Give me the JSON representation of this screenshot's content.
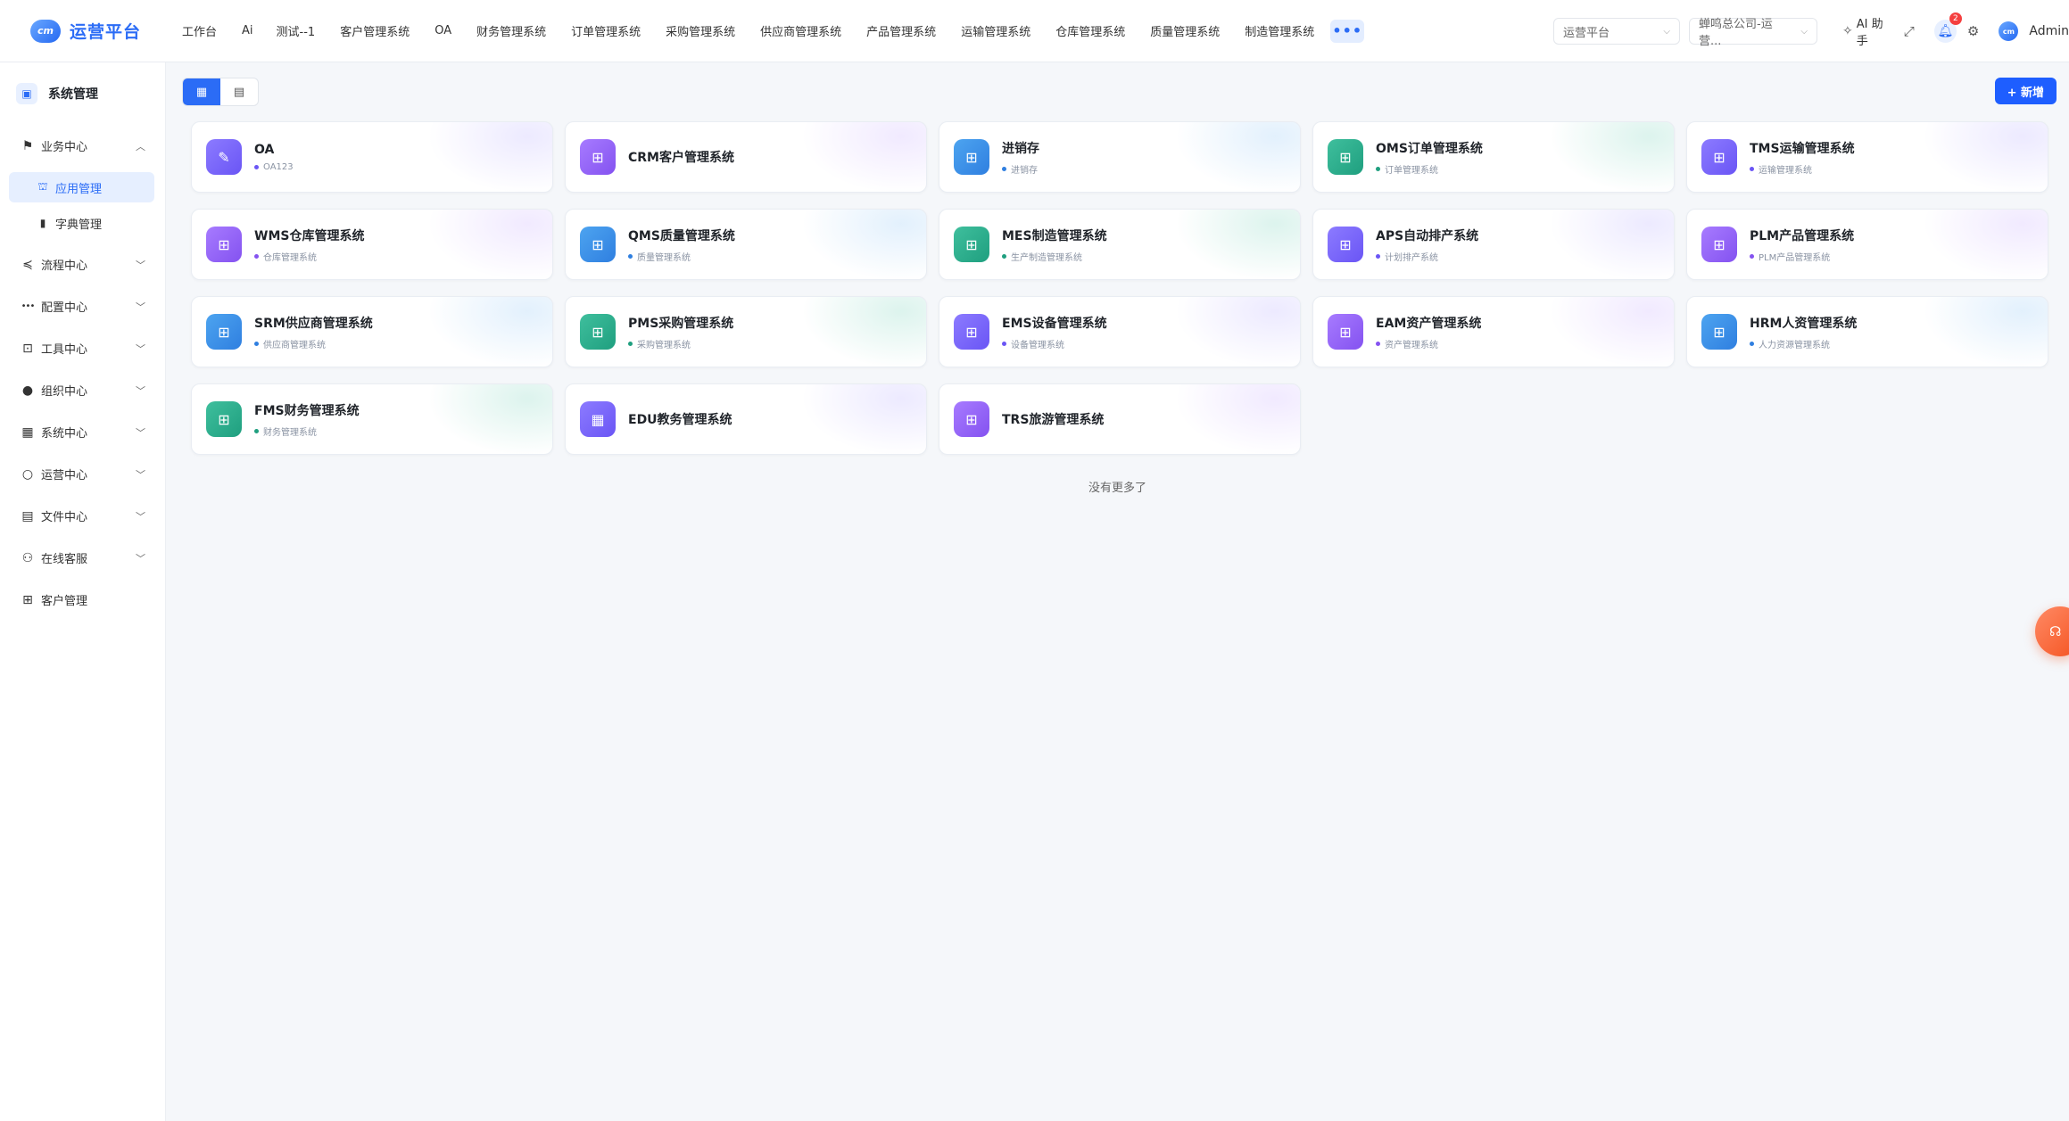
{
  "brand": {
    "logo_text": "cm",
    "name": "运营平台"
  },
  "nav": {
    "items": [
      "工作台",
      "Ai",
      "测试--1",
      "客户管理系统",
      "OA",
      "财务管理系统",
      "订单管理系统",
      "采购管理系统",
      "供应商管理系统",
      "产品管理系统",
      "运输管理系统",
      "仓库管理系统",
      "质量管理系统",
      "制造管理系统"
    ],
    "more_label": "•••"
  },
  "header": {
    "platform_select": "运营平台",
    "company_select": "蝉鸣总公司-运营...",
    "ai_label": "AI 助手",
    "notification_count": "2",
    "avatar_text": "cm",
    "user_name": "Admin"
  },
  "sidebar": {
    "title": "系统管理",
    "items": [
      {
        "label": "业务中心",
        "icon": "flag-icon",
        "glyph": "⚑",
        "expanded": true,
        "children": [
          {
            "label": "应用管理",
            "icon": "bag-icon",
            "glyph": "⛫",
            "active": true
          },
          {
            "label": "字典管理",
            "icon": "book-icon",
            "glyph": "▮",
            "active": false
          }
        ]
      },
      {
        "label": "流程中心",
        "icon": "flow-icon",
        "glyph": "≼"
      },
      {
        "label": "配置中心",
        "icon": "dots-icon",
        "glyph": "•••"
      },
      {
        "label": "工具中心",
        "icon": "toolbox-icon",
        "glyph": "⊡"
      },
      {
        "label": "组织中心",
        "icon": "person-icon",
        "glyph": "●"
      },
      {
        "label": "系统中心",
        "icon": "grid-icon",
        "glyph": "▦"
      },
      {
        "label": "运营中心",
        "icon": "user-outline-icon",
        "glyph": "○"
      },
      {
        "label": "文件中心",
        "icon": "folder-icon",
        "glyph": "▤"
      },
      {
        "label": "在线客服",
        "icon": "support-icon",
        "glyph": "⚇"
      },
      {
        "label": "客户管理",
        "icon": "apps-icon",
        "glyph": "⊞"
      }
    ]
  },
  "toolbar": {
    "add_label": "+ 新增"
  },
  "apps": [
    {
      "title": "OA",
      "sub": "OA123",
      "color": "purple",
      "dot": "#6a55f5",
      "glyph": "✎"
    },
    {
      "title": "CRM客户管理系统",
      "sub": "",
      "color": "violet",
      "dot": "#8452f0",
      "glyph": "⊞"
    },
    {
      "title": "进销存",
      "sub": "进销存",
      "color": "blue",
      "dot": "#2f7fe0",
      "glyph": "⊞"
    },
    {
      "title": "OMS订单管理系统",
      "sub": "订单管理系统",
      "color": "teal",
      "dot": "#1f9f7f",
      "glyph": "⊞"
    },
    {
      "title": "TMS运输管理系统",
      "sub": "运输管理系统",
      "color": "purple",
      "dot": "#6a55f5",
      "glyph": "⊞"
    },
    {
      "title": "WMS仓库管理系统",
      "sub": "仓库管理系统",
      "color": "violet",
      "dot": "#8452f0",
      "glyph": "⊞"
    },
    {
      "title": "QMS质量管理系统",
      "sub": "质量管理系统",
      "color": "blue",
      "dot": "#2f7fe0",
      "glyph": "⊞"
    },
    {
      "title": "MES制造管理系统",
      "sub": "生产制造管理系统",
      "color": "teal",
      "dot": "#1f9f7f",
      "glyph": "⊞"
    },
    {
      "title": "APS自动排产系统",
      "sub": "计划排产系统",
      "color": "purple",
      "dot": "#6a55f5",
      "glyph": "⊞"
    },
    {
      "title": "PLM产品管理系统",
      "sub": "PLM产品管理系统",
      "color": "violet",
      "dot": "#8452f0",
      "glyph": "⊞"
    },
    {
      "title": "SRM供应商管理系统",
      "sub": "供应商管理系统",
      "color": "blue",
      "dot": "#2f7fe0",
      "glyph": "⊞"
    },
    {
      "title": "PMS采购管理系统",
      "sub": "采购管理系统",
      "color": "teal",
      "dot": "#1f9f7f",
      "glyph": "⊞"
    },
    {
      "title": "EMS设备管理系统",
      "sub": "设备管理系统",
      "color": "purple",
      "dot": "#6a55f5",
      "glyph": "⊞"
    },
    {
      "title": "EAM资产管理系统",
      "sub": "资产管理系统",
      "color": "violet",
      "dot": "#8452f0",
      "glyph": "⊞"
    },
    {
      "title": "HRM人资管理系统",
      "sub": "人力资源管理系统",
      "color": "blue",
      "dot": "#2f7fe0",
      "glyph": "⊞"
    },
    {
      "title": "FMS财务管理系统",
      "sub": "财务管理系统",
      "color": "teal",
      "dot": "#1f9f7f",
      "glyph": "⊞"
    },
    {
      "title": "EDU教务管理系统",
      "sub": "",
      "color": "purple",
      "dot": "#6a55f5",
      "glyph": "▦"
    },
    {
      "title": "TRS旅游管理系统",
      "sub": "",
      "color": "violet",
      "dot": "#8452f0",
      "glyph": "⊞"
    }
  ],
  "footer_text": "没有更多了",
  "colors": {
    "accent": "#2b6cf6",
    "primary_button": "#1e5eff",
    "support_fab": "#f4511e"
  }
}
